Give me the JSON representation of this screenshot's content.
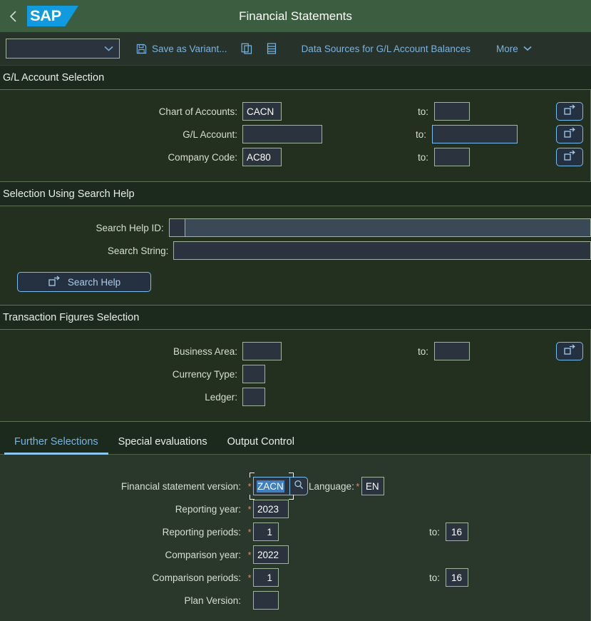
{
  "shell": {
    "back_icon": "chevron-left-icon",
    "logo_text": "SAP",
    "title": "Financial Statements"
  },
  "toolbar": {
    "variant_value": "",
    "variant_placeholder": "",
    "save_variant_label": "Save as Variant...",
    "save_icon": "save-floppy-icon",
    "copy_icon": "copy-icon",
    "list_icon": "list-icon",
    "data_sources_label": "Data Sources for G/L Account Balances",
    "more_label": "More",
    "more_icon": "chevron-down-icon"
  },
  "sections": {
    "gl_account": {
      "title": "G/L Account Selection",
      "rows": [
        {
          "label": "Chart of Accounts:",
          "value": "CACN",
          "to_label": "to:",
          "to_value": "",
          "multi_icon": "multi-selection-icon"
        },
        {
          "label": "G/L Account:",
          "value": "",
          "to_label": "to:",
          "to_value": "",
          "multi_icon": "multi-selection-icon"
        },
        {
          "label": "Company Code:",
          "value": "AC80",
          "to_label": "to:",
          "to_value": "",
          "multi_icon": "multi-selection-icon"
        }
      ]
    },
    "search_help": {
      "title": "Selection Using Search Help",
      "id_label": "Search Help ID:",
      "id_value": "",
      "string_label": "Search String:",
      "string_value": "",
      "button_label": "Search Help",
      "button_icon": "multi-selection-icon"
    },
    "transaction_figures": {
      "title": "Transaction Figures Selection",
      "rows": [
        {
          "label": "Business Area:",
          "value": "",
          "to_label": "to:",
          "to_value": "",
          "multi_icon": "multi-selection-icon"
        },
        {
          "label": "Currency Type:",
          "value": ""
        },
        {
          "label": "Ledger:",
          "value": ""
        }
      ]
    }
  },
  "tabs": [
    {
      "label": "Further Selections",
      "active": true
    },
    {
      "label": "Special evaluations",
      "active": false
    },
    {
      "label": "Output Control",
      "active": false
    }
  ],
  "further_selections": {
    "fsv_label": "Financial statement version:",
    "fsv_value": "ZACN",
    "fsv_required": "*",
    "fsv_help_icon": "value-help-search-icon",
    "language_label": "Language:",
    "language_required": "*",
    "language_value": "EN",
    "reporting_year_label": "Reporting year:",
    "reporting_year_required": "*",
    "reporting_year_value": "2023",
    "reporting_periods_label": "Reporting periods:",
    "reporting_periods_required": "*",
    "reporting_periods_value": "1",
    "reporting_periods_to_label": "to:",
    "reporting_periods_to_value": "16",
    "comparison_year_label": "Comparison year:",
    "comparison_year_required": "*",
    "comparison_year_value": "2022",
    "comparison_periods_label": "Comparison periods:",
    "comparison_periods_required": "*",
    "comparison_periods_value": "1",
    "comparison_periods_to_label": "to:",
    "comparison_periods_to_value": "16",
    "plan_version_label": "Plan Version:",
    "plan_version_value": ""
  },
  "colors": {
    "shell_header": "#3c5d3f",
    "toolbar_bg": "#27332a",
    "page_bg": "#1c2a1e",
    "panel_bg": "#24301f",
    "tabpanel_bg": "#2a382b",
    "field_bg": "#2b333e",
    "field_border": "#9fb699",
    "accent_blue": "#7ab3e0",
    "focus_blue": "#78bdf0",
    "required_star": "#d98b74",
    "sap_logo_blue": "#109adf",
    "selection_blue": "#3f7fc4"
  }
}
